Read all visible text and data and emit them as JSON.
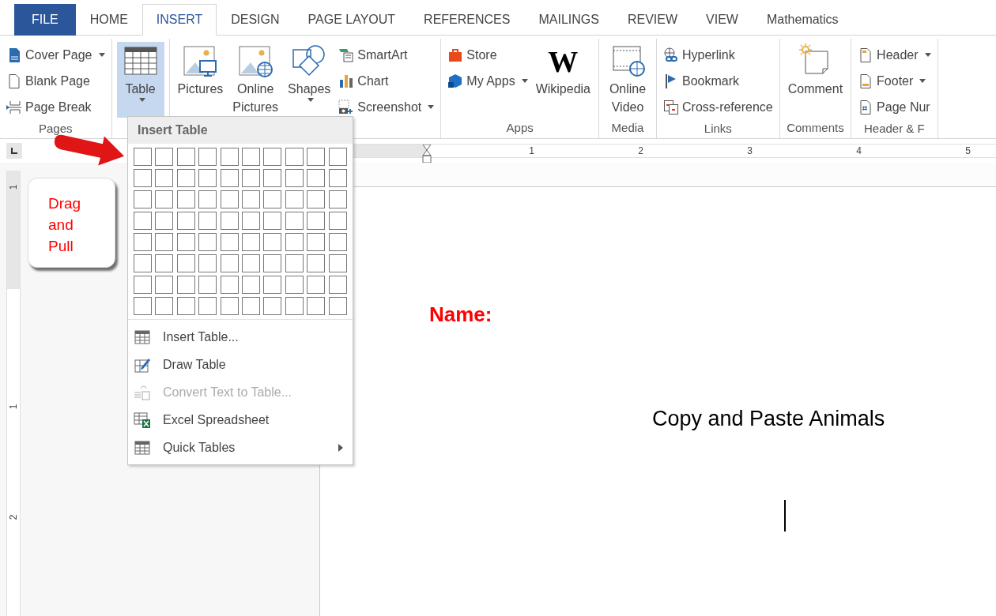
{
  "tabs": [
    {
      "label": "FILE",
      "kind": "file",
      "selected": false
    },
    {
      "label": "HOME",
      "kind": "tab",
      "selected": false
    },
    {
      "label": "INSERT",
      "kind": "tab",
      "selected": true
    },
    {
      "label": "DESIGN",
      "kind": "tab",
      "selected": false
    },
    {
      "label": "PAGE LAYOUT",
      "kind": "tab",
      "selected": false
    },
    {
      "label": "REFERENCES",
      "kind": "tab",
      "selected": false
    },
    {
      "label": "MAILINGS",
      "kind": "tab",
      "selected": false
    },
    {
      "label": "REVIEW",
      "kind": "tab",
      "selected": false
    },
    {
      "label": "VIEW",
      "kind": "tab",
      "selected": false
    },
    {
      "label": "Mathematics",
      "kind": "tab",
      "selected": false
    }
  ],
  "ribbon": {
    "groups": [
      {
        "label": "Pages",
        "items": [
          {
            "label": "Cover Page",
            "kind": "small",
            "dropdown": true
          },
          {
            "label": "Blank Page",
            "kind": "small",
            "dropdown": false
          },
          {
            "label": "Page Break",
            "kind": "small",
            "dropdown": false
          }
        ]
      },
      {
        "items": [
          {
            "label": "Table",
            "kind": "large",
            "dropdown": true,
            "pressed": true
          }
        ]
      },
      {
        "items": [
          {
            "label": "Pictures",
            "kind": "large",
            "dropdown": false
          },
          {
            "label": "Online Pictures",
            "kind": "large",
            "dropdown": false
          },
          {
            "label": "Shapes",
            "kind": "large",
            "dropdown": true
          },
          {
            "label": "SmartArt",
            "kind": "small",
            "dropdown": false
          },
          {
            "label": "Chart",
            "kind": "small",
            "dropdown": false
          },
          {
            "label": "Screenshot",
            "kind": "small",
            "dropdown": true
          }
        ]
      },
      {
        "label": "Apps",
        "items": [
          {
            "label": "Store",
            "kind": "small",
            "dropdown": false
          },
          {
            "label": "My Apps",
            "kind": "small",
            "dropdown": true
          },
          {
            "label": "Wikipedia",
            "kind": "large",
            "dropdown": false,
            "glyph": "W"
          }
        ]
      },
      {
        "label": "Media",
        "items": [
          {
            "label": "Online Video",
            "kind": "large",
            "dropdown": false
          }
        ]
      },
      {
        "label": "Links",
        "items": [
          {
            "label": "Hyperlink",
            "kind": "small",
            "dropdown": false
          },
          {
            "label": "Bookmark",
            "kind": "small",
            "dropdown": false
          },
          {
            "label": "Cross-reference",
            "kind": "small",
            "dropdown": false
          }
        ]
      },
      {
        "label": "Comments",
        "items": [
          {
            "label": "Comment",
            "kind": "large",
            "dropdown": false
          }
        ]
      },
      {
        "label": "Header & F",
        "items": [
          {
            "label": "Header",
            "kind": "small",
            "dropdown": true
          },
          {
            "label": "Footer",
            "kind": "small",
            "dropdown": true
          },
          {
            "label": "Page Nur",
            "kind": "small",
            "dropdown": false
          }
        ]
      }
    ]
  },
  "ruler": {
    "labels": [
      "1",
      "2",
      "3",
      "4",
      "5"
    ]
  },
  "vertical_ruler": {
    "labels": [
      "1",
      "1",
      "2"
    ]
  },
  "insert_table_menu": {
    "title": "Insert Table",
    "items": [
      {
        "label": "Insert Table...",
        "disabled": false,
        "submenu": false
      },
      {
        "label": "Draw Table",
        "disabled": false,
        "submenu": false
      },
      {
        "label": "Convert Text to Table...",
        "disabled": true,
        "submenu": false
      },
      {
        "label": "Excel Spreadsheet",
        "disabled": false,
        "submenu": false
      },
      {
        "label": "Quick Tables",
        "disabled": false,
        "submenu": true
      }
    ]
  },
  "callout": {
    "text": "Drag and Pull"
  },
  "document": {
    "name_label": "Name:",
    "heading": "Copy and Paste Animals"
  }
}
